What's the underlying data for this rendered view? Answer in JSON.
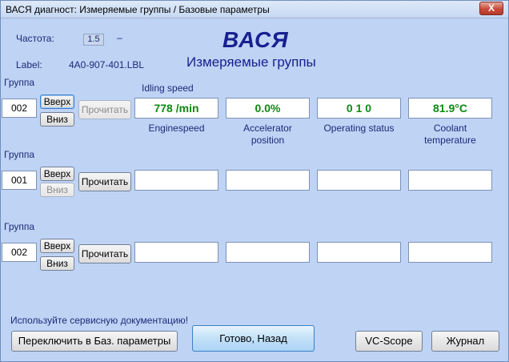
{
  "window": {
    "title": "ВАСЯ диагност: Измеряемые группы / Базовые параметры",
    "close_label": "X"
  },
  "header": {
    "freq_label": "Частота:",
    "freq_value": "1.5",
    "freq_dash": "–",
    "label_label": "Label:",
    "label_value": "4A0-907-401.LBL",
    "brand": "ВАСЯ",
    "subtitle": "Измеряемые группы"
  },
  "groups": [
    {
      "label": "Группа",
      "number": "002",
      "up": "Вверх",
      "down": "Вниз",
      "read": "Прочитать",
      "subheading": "Idling speed",
      "fields": [
        "778 /min",
        "0.0%",
        "0  1  0",
        "81.9°C"
      ],
      "captions": [
        "Enginespeed",
        "Accelerator position",
        "Operating status",
        "Coolant temperature"
      ]
    },
    {
      "label": "Группа",
      "number": "001",
      "up": "Вверх",
      "down": "Вниз",
      "read": "Прочитать",
      "fields": [
        "",
        "",
        "",
        ""
      ]
    },
    {
      "label": "Группа",
      "number": "002",
      "up": "Вверх",
      "down": "Вниз",
      "read": "Прочитать",
      "fields": [
        "",
        "",
        "",
        ""
      ]
    }
  ],
  "footer": {
    "hint": "Используйте сервисную документацию!",
    "switch_button": "Переключить в Баз. параметры",
    "ok_button": "Готово, Назад",
    "scope_button": "VC-Scope",
    "journal_button": "Журнал"
  },
  "colors": {
    "value_green": "#0e8a12",
    "label_blue": "#1a2a78",
    "brand_blue": "#17208f"
  }
}
